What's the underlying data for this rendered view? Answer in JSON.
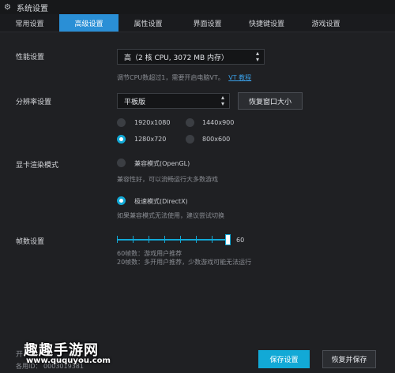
{
  "window": {
    "title": "系统设置",
    "icon": "gear-icon"
  },
  "tabs": [
    {
      "label": "常用设置",
      "active": false
    },
    {
      "label": "高级设置",
      "active": true
    },
    {
      "label": "属性设置",
      "active": false
    },
    {
      "label": "界面设置",
      "active": false
    },
    {
      "label": "快捷键设置",
      "active": false
    },
    {
      "label": "游戏设置",
      "active": false
    }
  ],
  "performance": {
    "label": "性能设置",
    "selected": "高（2 核 CPU, 3072 MB 内存）",
    "hint": "调节CPU数超过1，需要开启电脑VT。",
    "hint_link": "VT 教程"
  },
  "resolution": {
    "label": "分辨率设置",
    "selected": "平板版",
    "restore_button": "恢复窗口大小",
    "options": [
      "1920x1080",
      "1440x900",
      "1280x720",
      "800x600"
    ],
    "selected_option": "1280x720"
  },
  "render": {
    "label": "显卡渲染模式",
    "compat_label": "兼容模式(OpenGL)",
    "compat_hint": "兼容性好，可以流畅运行大多数游戏",
    "speed_label": "极速模式(DirectX)",
    "speed_hint": "如果兼容模式无法使用，建议尝试切换",
    "selected": "speed"
  },
  "fps": {
    "label": "帧数设置",
    "value": "60",
    "hint1": "60帧数：游戏用户推荐",
    "hint2": "20帧数：多开用户推荐，少数游戏可能无法运行"
  },
  "footer": {
    "left_line1": "开",
    "left_line2": "各用ID：  0003019381",
    "save_button": "保存设置",
    "restore_save_button": "恢复并保存"
  },
  "watermark": {
    "line1": "趣趣手游网",
    "line2": "www.ququyou.com"
  },
  "colors": {
    "accent": "#12a9d6",
    "tab_active": "#2a8fd6",
    "background": "#1f2023"
  }
}
